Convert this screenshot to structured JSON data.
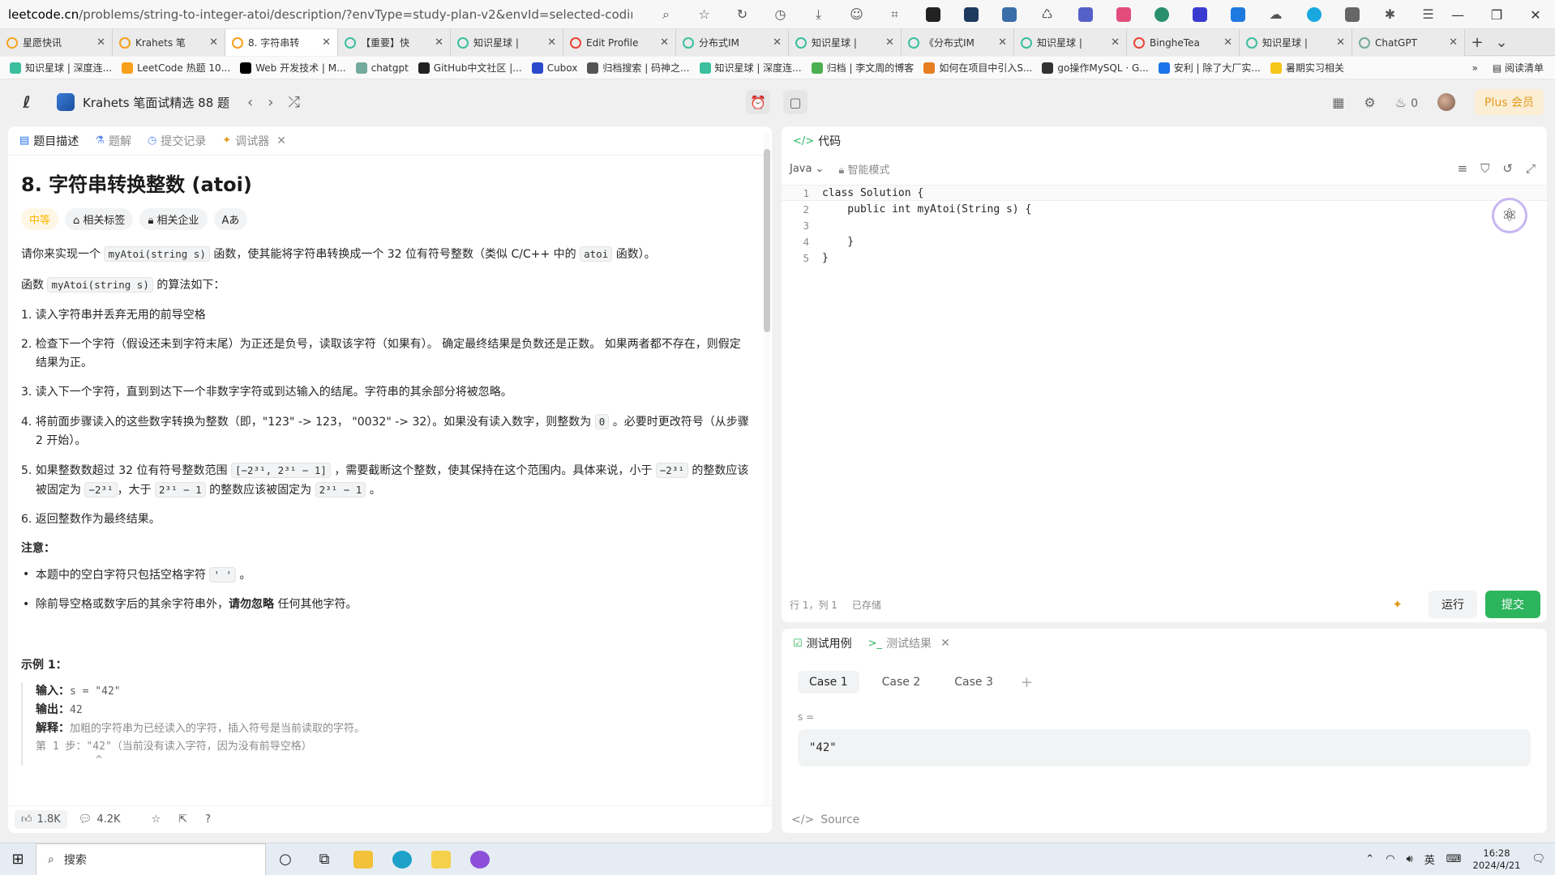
{
  "browser": {
    "url_host": "leetcode.cn",
    "url_path": "/problems/string-to-integer-atoi/description/?envType=study-plan-v2&envId=selected-coding-inter...",
    "tabs": [
      {
        "label": "星愿快讯",
        "icon": "star-tab-icon",
        "color": "#f5a623",
        "active": false
      },
      {
        "label": "Krahets 笔",
        "icon": "leetcode-tab-icon",
        "color": "#f89f1b",
        "active": false
      },
      {
        "label": "8. 字符串转",
        "icon": "leetcode-tab-icon",
        "color": "#f89f1b",
        "active": true
      },
      {
        "label": "【重要】快",
        "icon": "zsxq-tab-icon",
        "color": "#3bbf9e",
        "active": false
      },
      {
        "label": "知识星球 |",
        "icon": "zsxq-tab-icon",
        "color": "#3bbf9e",
        "active": false
      },
      {
        "label": "Edit Profile",
        "icon": "google-tab-icon",
        "color": "#ea4335",
        "active": false
      },
      {
        "label": "分布式IM",
        "icon": "zsxq-tab-icon",
        "color": "#3bbf9e",
        "active": false
      },
      {
        "label": "知识星球 |",
        "icon": "zsxq-tab-icon",
        "color": "#3bbf9e",
        "active": false
      },
      {
        "label": "《分布式IM",
        "icon": "zsxq-tab-icon",
        "color": "#3bbf9e",
        "active": false
      },
      {
        "label": "知识星球 |",
        "icon": "zsxq-tab-icon",
        "color": "#3bbf9e",
        "active": false
      },
      {
        "label": "BingheTea",
        "icon": "google-tab-icon",
        "color": "#ea4335",
        "active": false
      },
      {
        "label": "知识星球 |",
        "icon": "zsxq-tab-icon",
        "color": "#3bbf9e",
        "active": false
      },
      {
        "label": "ChatGPT",
        "icon": "chatgpt-tab-icon",
        "color": "#74aa9c",
        "active": false
      }
    ],
    "bookmarks": [
      {
        "label": "知识星球 | 深度连...",
        "color": "#3bbf9e"
      },
      {
        "label": "LeetCode 热题 10...",
        "color": "#f89f1b"
      },
      {
        "label": "Web 开发技术 | M...",
        "color": "#000000"
      },
      {
        "label": "chatgpt",
        "color": "#74aa9c"
      },
      {
        "label": "GitHub中文社区 |...",
        "color": "#222222"
      },
      {
        "label": "Cubox",
        "color": "#2b4acb"
      },
      {
        "label": "归档搜索 | 码神之...",
        "color": "#555555"
      },
      {
        "label": "知识星球 | 深度连...",
        "color": "#3bbf9e"
      },
      {
        "label": "归档 | 李文周的博客",
        "color": "#4caf50"
      },
      {
        "label": "如何在项目中引入S...",
        "color": "#e67e22"
      },
      {
        "label": "go操作MySQL · G...",
        "color": "#333333"
      },
      {
        "label": "安利 | 除了大厂实...",
        "color": "#1a73e8"
      },
      {
        "label": "暑期实习相关",
        "color": "#f5c518"
      }
    ],
    "reading_list": "阅读清单"
  },
  "header": {
    "plan_title": "Krahets 笔面试精选 88 题",
    "flame_count": "0",
    "plus_label": "Plus 会员"
  },
  "left": {
    "tabs": [
      {
        "label": "题目描述",
        "icon": "description-icon",
        "active": true
      },
      {
        "label": "题解",
        "icon": "flask-icon",
        "active": false
      },
      {
        "label": "提交记录",
        "icon": "history-icon",
        "active": false
      },
      {
        "label": "调试器",
        "icon": "debugger-icon",
        "active": false
      }
    ],
    "title": "8. 字符串转换整数 (atoi)",
    "tags": [
      {
        "label": "中等",
        "kind": "difficulty"
      },
      {
        "label": "相关标签",
        "kind": "tag"
      },
      {
        "label": "相关企业",
        "kind": "lock"
      },
      {
        "label": "Aあ",
        "kind": "lang"
      }
    ],
    "intro_1": "请你来实现一个",
    "intro_code": "myAtoi(string s)",
    "intro_2": "函数，使其能将字符串转换成一个 32 位有符号整数（类似 C/C++ 中的",
    "intro_code2": "atoi",
    "intro_3": "函数）。",
    "algo_1": "函数",
    "algo_code": "myAtoi(string s)",
    "algo_2": "的算法如下：",
    "step1": "1. 读入字符串并丢弃无用的前导空格",
    "step2": "2. 检查下一个字符（假设还未到字符末尾）为正还是负号，读取该字符（如果有）。 确定最终结果是负数还是正数。 如果两者都不存在，则假定结果为正。",
    "step3": "3. 读入下一个字符，直到到达下一个非数字字符或到达输入的结尾。字符串的其余部分将被忽略。",
    "step4_a": "4. 将前面步骤读入的这些数字转换为整数（即，\"123\" -> 123， \"0032\" -> 32）。如果没有读入数字，则整数为",
    "step4_code": "0",
    "step4_b": "。必要时更改符号（从步骤 2 开始）。",
    "step5_a": "5. 如果整数数超过 32 位有符号整数范围",
    "step5_range": "[−2³¹,  2³¹ − 1]",
    "step5_b": "，需要截断这个整数，使其保持在这个范围内。具体来说，小于",
    "step5_lo": "−2³¹",
    "step5_c": "的整数应该被固定为",
    "step5_lo2": "−2³¹",
    "step5_d": "，大于",
    "step5_hi": "2³¹ − 1",
    "step5_e": "的整数应该被固定为",
    "step5_hi2": "2³¹ − 1",
    "step5_f": "。",
    "step6": "6. 返回整数作为最终结果。",
    "note_title": "注意：",
    "note1_a": "本题中的空白字符只包括空格字符",
    "note1_code": "' '",
    "note1_b": "。",
    "note2_a": "除前导空格或数字后的其余字符串外，",
    "note2_bold": "请勿忽略",
    "note2_b": "任何其他字符。",
    "example_title": "示例 1：",
    "ex_input_label": "输入：",
    "ex_input": "s = \"42\"",
    "ex_output_label": "输出：",
    "ex_output": "42",
    "ex_explain_label": "解释：",
    "ex_explain": "加粗的字符串为已经读入的字符，插入符号是当前读取的字符。",
    "ex_step1": "第 1 步：\"42\"（当前没有读入字符，因为没有前导空格）",
    "ex_caret": "^",
    "likes": "1.8K",
    "comments": "4.2K"
  },
  "code": {
    "title": "代码",
    "language": "Java",
    "mode": "智能模式",
    "lines": [
      {
        "n": "1",
        "text": "class Solution {"
      },
      {
        "n": "2",
        "text": "    public int myAtoi(String s) {"
      },
      {
        "n": "3",
        "text": ""
      },
      {
        "n": "4",
        "text": "    }"
      },
      {
        "n": "5",
        "text": "}"
      }
    ],
    "cursor": "行 1，列 1",
    "saved": "已存储",
    "run_label": "运行",
    "submit_label": "提交"
  },
  "test": {
    "tab_cases": "测试用例",
    "tab_result": "测试结果",
    "cases": [
      "Case 1",
      "Case 2",
      "Case 3"
    ],
    "var_label": "s =",
    "var_value": "\"42\"",
    "source_label": "Source"
  },
  "taskbar": {
    "search_placeholder": "搜索",
    "ime": "英",
    "time": "16:28",
    "date": "2024/4/21"
  }
}
